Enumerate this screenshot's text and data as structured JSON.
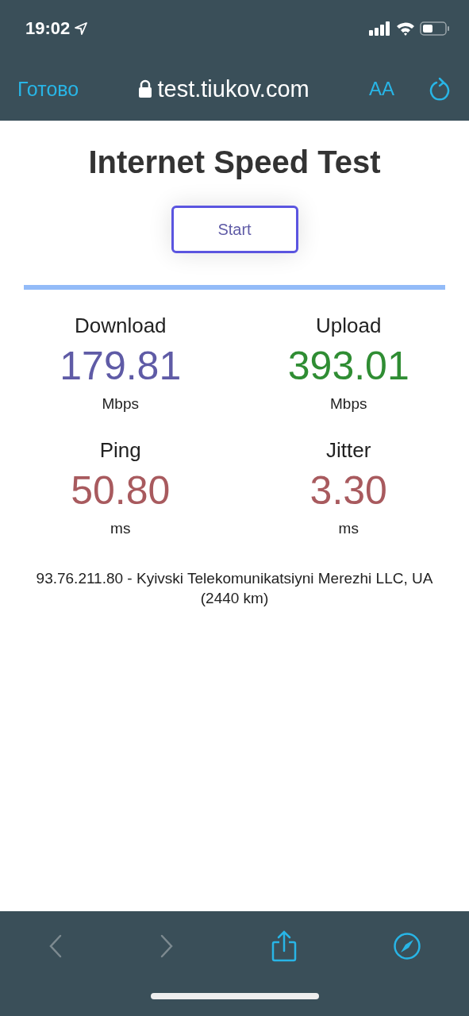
{
  "status_bar": {
    "time": "19:02"
  },
  "browser_bar": {
    "done_label": "Готово",
    "address": "test.tiukov.com",
    "text_size_label": "AA"
  },
  "page": {
    "title": "Internet Speed Test",
    "start_button": "Start",
    "metrics": [
      {
        "label": "Download",
        "value": "179.81",
        "unit": "Mbps",
        "color": "#5f5ba6"
      },
      {
        "label": "Upload",
        "value": "393.01",
        "unit": "Mbps",
        "color": "#2f8d33"
      },
      {
        "label": "Ping",
        "value": "50.80",
        "unit": "ms",
        "color": "#a85a5e"
      },
      {
        "label": "Jitter",
        "value": "3.30",
        "unit": "ms",
        "color": "#a85a5e"
      }
    ],
    "server_info": "93.76.211.80 - Kyivski Telekomunikatsiyni Merezhi LLC, UA (2440 km)"
  },
  "toolbar": {
    "back_disabled": true,
    "forward_disabled": true
  }
}
